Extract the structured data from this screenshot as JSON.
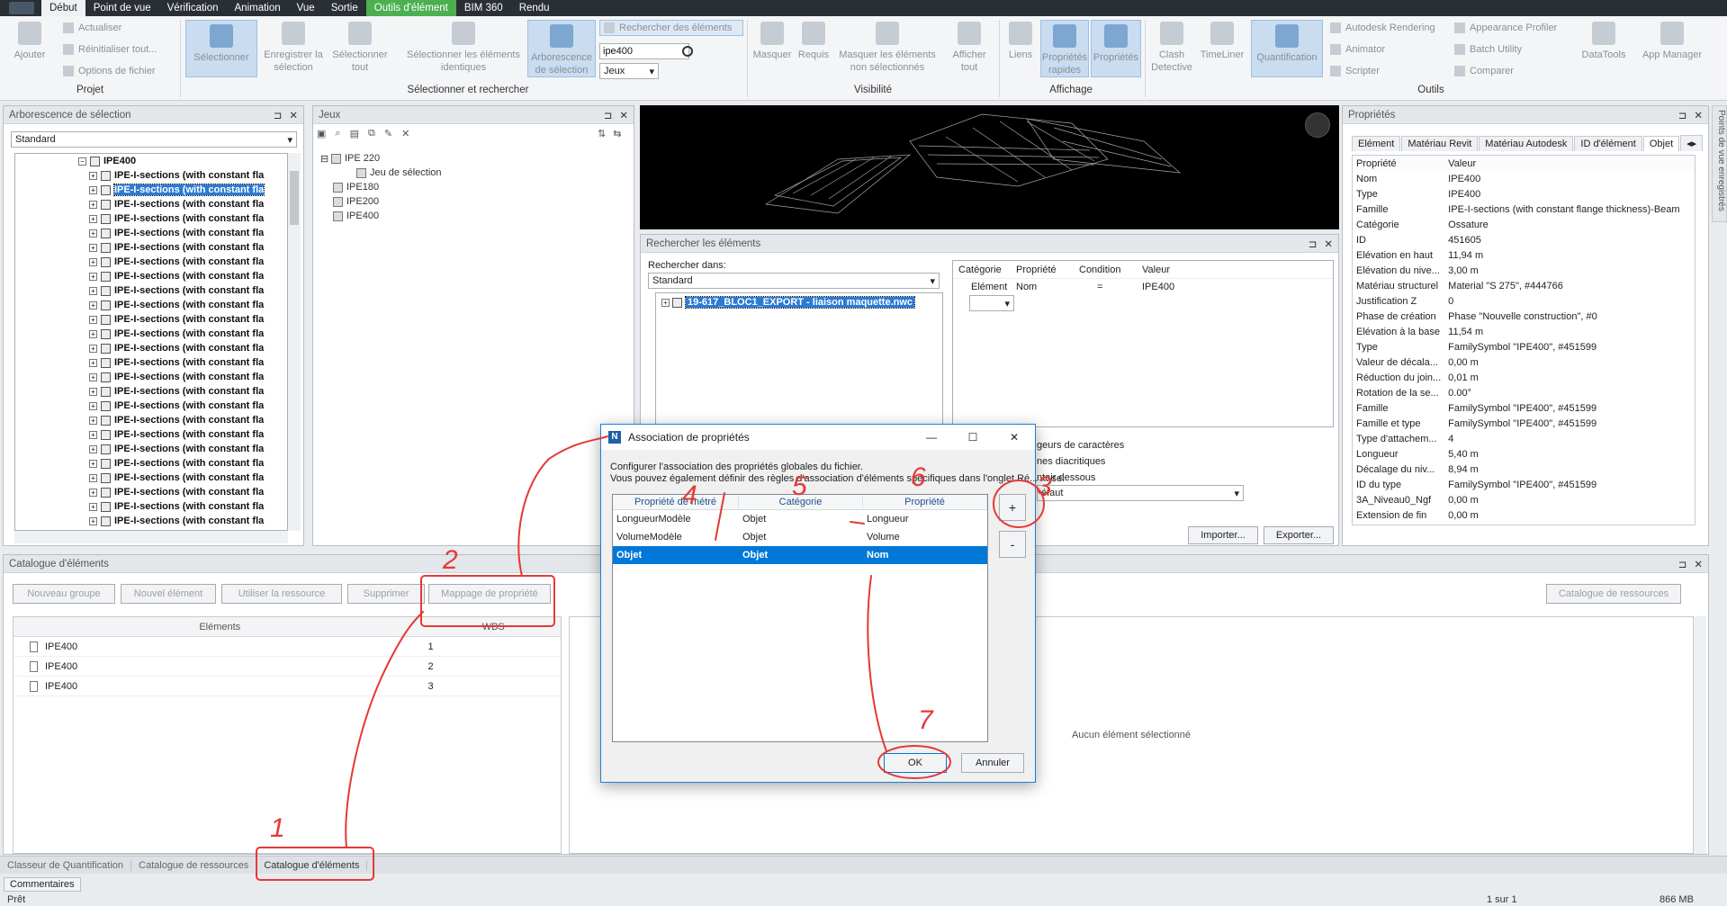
{
  "menu": {
    "tabs": [
      "Début",
      "Point de vue",
      "Vérification",
      "Animation",
      "Vue",
      "Sortie",
      "Outils d'élément",
      "BIM 360",
      "Rendu"
    ]
  },
  "ribbon": {
    "projet": {
      "ajouter": "Ajouter",
      "actualiser": "Actualiser",
      "reinitialiser": "Réinitialiser tout...",
      "options": "Options de fichier",
      "group_label": "Projet"
    },
    "selection": {
      "selectionner": "Sélectionner",
      "enregistrer": "Enregistrer la sélection",
      "selectionner_tout": "Sélectionner tout",
      "selectionner_identiques": "Sélectionner les éléments identiques",
      "arborescence": "Arborescence de sélection",
      "rechercher_elements": "Rechercher des éléments",
      "search_value": "ipe400",
      "jeux": "Jeux",
      "group_label": "Sélectionner et rechercher"
    },
    "visibilite": {
      "masquer": "Masquer",
      "requis": "Requis",
      "masquer_non_sel": "Masquer les éléments non sélectionnés",
      "afficher_tout": "Afficher tout",
      "group_label": "Visibilité"
    },
    "affichage": {
      "liens": "Liens",
      "proprietes_rapides": "Propriétés rapides",
      "proprietes": "Propriétés",
      "group_label": "Affichage"
    },
    "outils": {
      "clash": "Clash Detective",
      "timeliner": "TimeLiner",
      "quantification": "Quantification",
      "autodesk_rendering": "Autodesk Rendering",
      "animator": "Animator",
      "scripter": "Scripter",
      "appearance_profiler": "Appearance Profiler",
      "batch_utility": "Batch Utility",
      "comparer": "Comparer",
      "datatools": "DataTools",
      "app_manager": "App Manager",
      "group_label": "Outils"
    }
  },
  "arborescence": {
    "title": "Arborescence de sélection",
    "dropdown": "Standard",
    "root": "IPE400",
    "item_label": "IPE-I-sections (with constant fla",
    "selected_index": 1
  },
  "jeux": {
    "title": "Jeux",
    "items": [
      "IPE 220",
      "Jeu de sélection",
      "IPE180",
      "IPE200",
      "IPE400"
    ]
  },
  "rechercher": {
    "title": "Rechercher les éléments",
    "search_in_label": "Rechercher dans:",
    "dropdown": "Standard",
    "file": "19-617_BLOC1_EXPORT - liaison maquette.nwc",
    "columns": [
      "Catégorie",
      "Propriété",
      "Condition",
      "Valeur"
    ],
    "row": [
      "Elément",
      "Nom",
      "=",
      "IPE400"
    ],
    "opt1": "geurs de caractères",
    "opt2": "nes diacritiques",
    "opt3": "ntair dessous",
    "default": "éfaut",
    "importer": "Importer...",
    "exporter": "Exporter..."
  },
  "proprietes": {
    "title": "Propriétés",
    "tabs": [
      "Elément",
      "Matériau Revit",
      "Matériau Autodesk",
      "ID d'élément",
      "Objet"
    ],
    "col_prop": "Propriété",
    "col_val": "Valeur",
    "rows": [
      [
        "Nom",
        "IPE400"
      ],
      [
        "Type",
        "IPE400"
      ],
      [
        "Famille",
        "IPE-I-sections (with constant flange thickness)-Beam"
      ],
      [
        "Catégorie",
        "Ossature"
      ],
      [
        "ID",
        "451605"
      ],
      [
        "Elévation en haut",
        "11,94 m"
      ],
      [
        "Elévation du nive...",
        "3,00 m"
      ],
      [
        "Matériau structurel",
        "Material \"S 275\", #444766"
      ],
      [
        "Justification Z",
        "0"
      ],
      [
        "Phase de création",
        "Phase \"Nouvelle construction\", #0"
      ],
      [
        "Elévation à la base",
        "11,54 m"
      ],
      [
        "Type",
        "FamilySymbol \"IPE400\", #451599"
      ],
      [
        "Valeur de décala...",
        "0,00 m"
      ],
      [
        "Réduction du join...",
        "0,01 m"
      ],
      [
        "Rotation de la se...",
        "0.00°"
      ],
      [
        "Famille",
        "FamilySymbol \"IPE400\", #451599"
      ],
      [
        "Famille et type",
        "FamilySymbol \"IPE400\", #451599"
      ],
      [
        "Type d'attachem...",
        "4"
      ],
      [
        "Longueur",
        "5,40 m"
      ],
      [
        "Décalage du niv...",
        "8,94 m"
      ],
      [
        "ID du type",
        "FamilySymbol \"IPE400\", #451599"
      ],
      [
        "3A_Niveau0_Ngf",
        "0,00 m"
      ],
      [
        "Extension de fin",
        "0,00 m"
      ]
    ],
    "side_label": "Points de vue enregistrés"
  },
  "catalogue": {
    "title": "Catalogue d'éléments",
    "buttons": [
      "Nouveau groupe",
      "Nouvel élément",
      "Utiliser la ressource",
      "Supprimer",
      "Mappage de propriété"
    ],
    "resources_button": "Catalogue de ressources",
    "col_elements": "Eléments",
    "col_wbs": "WBS",
    "rows": [
      [
        "IPE400",
        "1"
      ],
      [
        "IPE400",
        "2"
      ],
      [
        "IPE400",
        "3"
      ]
    ],
    "empty": "Aucun élément sélectionné"
  },
  "dialog": {
    "title": "Association de propriétés",
    "line1": "Configurer l'association des propriétés globales du fichier.",
    "line2": "Vous pouvez également définir des règles d'association d'éléments spécifiques dans l'onglet Ré... ... se.",
    "columns": [
      "Propriété de métré",
      "Catégorie",
      "Propriété"
    ],
    "rows": [
      [
        "LongueurModèle",
        "Objet",
        "Longueur"
      ],
      [
        "VolumeModèle",
        "Objet",
        "Volume"
      ],
      [
        "Objet",
        "Objet",
        "Nom"
      ]
    ],
    "plus": "+",
    "minus": "-",
    "ok": "OK",
    "cancel": "Annuler"
  },
  "bottom": {
    "tabs": [
      "Classeur de Quantification",
      "Catalogue de ressources",
      "Catalogue d'éléments"
    ],
    "commentaires": "Commentaires",
    "status": "Prêt",
    "page": "1 sur 1",
    "memory": "866 MB"
  },
  "annotations": [
    "1",
    "2",
    "3",
    "4",
    "5",
    "6",
    "7"
  ]
}
